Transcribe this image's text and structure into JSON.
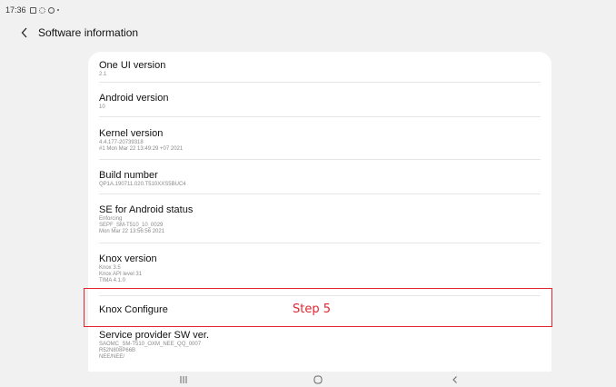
{
  "status_bar": {
    "time": "17:36",
    "icons": [
      "gallery-icon",
      "gear-icon",
      "circle-icon",
      "dot-icon"
    ]
  },
  "header": {
    "title": "Software information"
  },
  "items": [
    {
      "label": "One UI version",
      "sub": [
        "2.1"
      ]
    },
    {
      "label": "Android version",
      "sub": [
        "10"
      ]
    },
    {
      "label": "Kernel version",
      "sub": [
        "4.4.177-20739318",
        "#1 Mon Mar 22 13:49:29 +07 2021"
      ]
    },
    {
      "label": "Build number",
      "sub": [
        "QP1A.190711.020.T510XXS5BUC4"
      ]
    },
    {
      "label": "SE for Android status",
      "sub": [
        "Enforcing",
        "SEPF_SM-T510_10_0029",
        "Mon Mar 22 13:56:56 2021"
      ]
    },
    {
      "label": "Knox version",
      "sub": [
        "Knox 3.5",
        "Knox API level 31",
        "TIMA 4.1.0"
      ]
    },
    {
      "label": "Knox Configure",
      "sub": []
    },
    {
      "label": "Service provider SW ver.",
      "sub": [
        "SAOMC_SM-T510_OXM_NEE_QQ_0007",
        "R52N808P66B",
        "NEE/NEE/"
      ]
    }
  ],
  "annotation": {
    "text": "Step 5",
    "color": "#e0252f"
  },
  "nav": {
    "recents": "recents-icon",
    "home": "home-icon",
    "back": "back-icon"
  }
}
